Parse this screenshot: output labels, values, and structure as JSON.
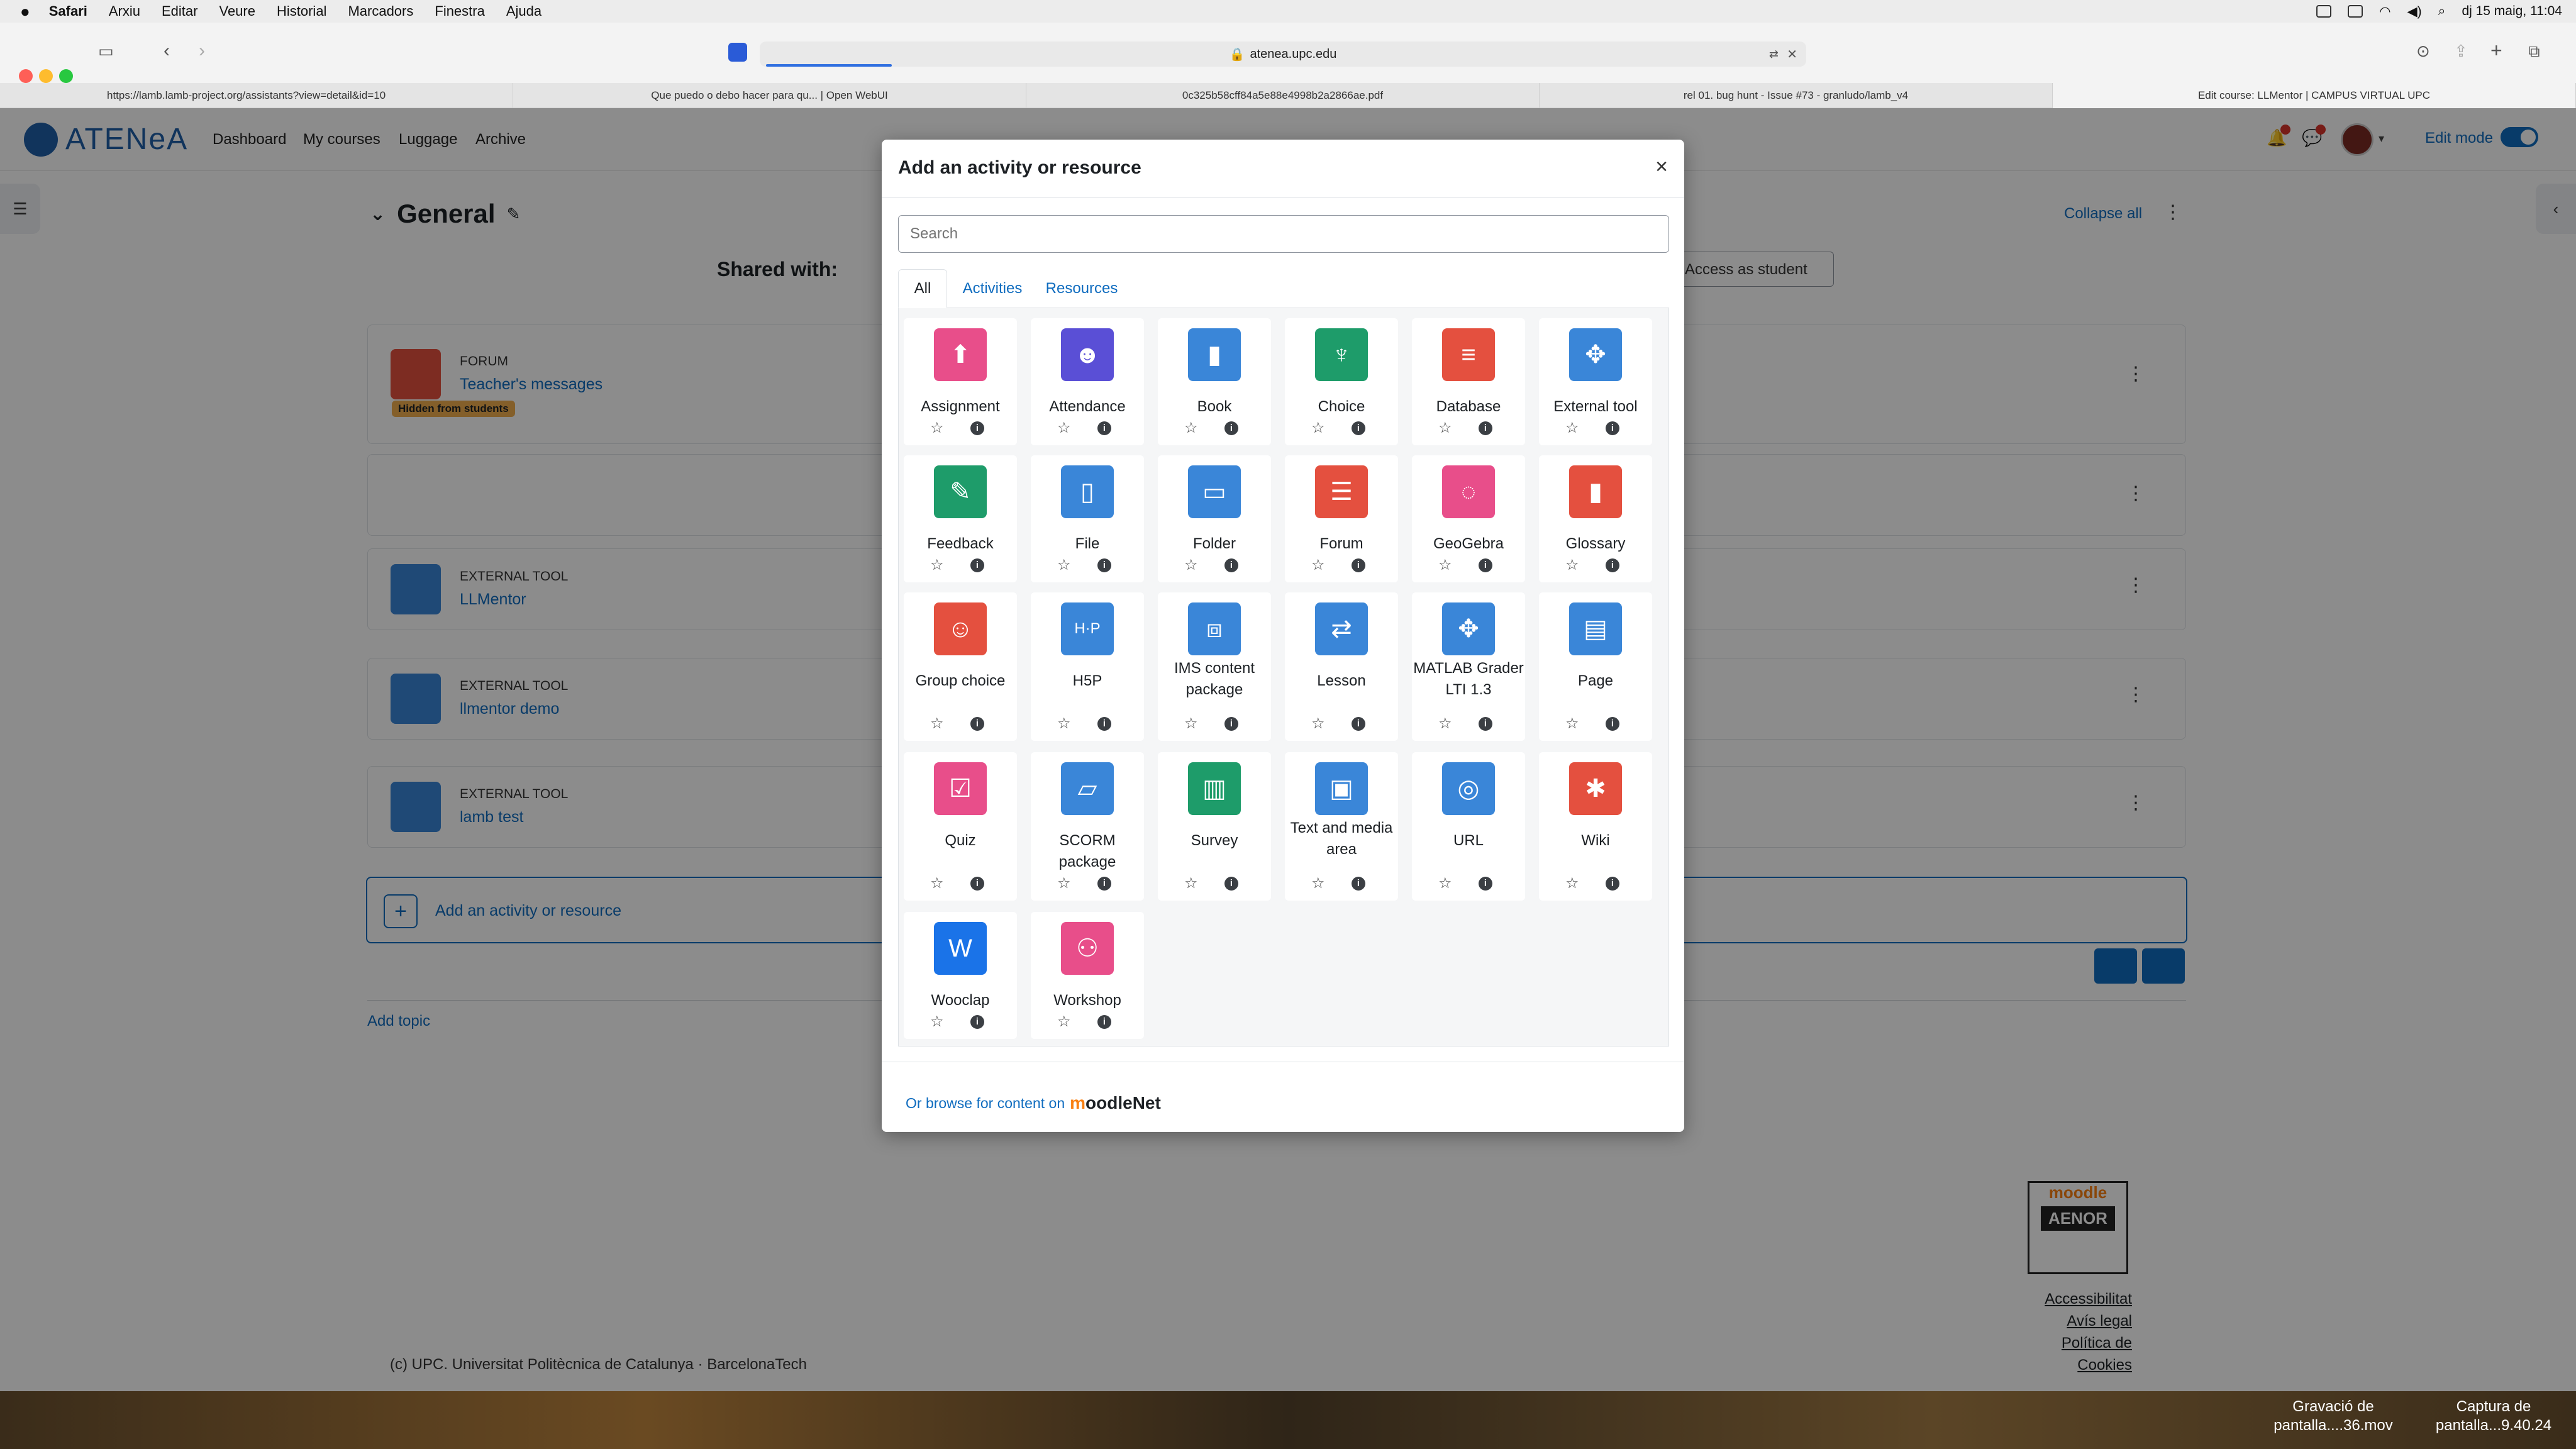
{
  "menubar": {
    "items": [
      "Safari",
      "Arxiu",
      "Editar",
      "Veure",
      "Historial",
      "Marcadors",
      "Finestra",
      "Ajuda"
    ],
    "clock": "dj 15 maig, 11:04"
  },
  "browser": {
    "url": "atenea.upc.edu",
    "tabs": [
      "https://lamb.lamb-project.org/assistants?view=detail&id=10",
      "Que puedo o debo hacer para qu... | Open WebUI",
      "0c325b58cff84a5e88e4998b2a2866ae.pdf",
      "rel 01. bug hunt - Issue #73 - granludo/lamb_v4",
      "Edit course: LLMentor | CAMPUS VIRTUAL UPC"
    ]
  },
  "navbar": {
    "logo": "ATENeA",
    "links": [
      "Dashboard",
      "My courses",
      "Luggage",
      "Archive"
    ],
    "edit_mode": "Edit mode"
  },
  "course": {
    "section_title": "General",
    "collapse_all": "Collapse all",
    "shared_with": "Shared with:",
    "access_as": "Access as student",
    "activities": [
      {
        "kind": "FORUM",
        "name": "Teacher's messages",
        "badge": "Hidden from students"
      },
      {
        "kind": "EXTERNAL TOOL",
        "name": "LLMentor"
      },
      {
        "kind": "EXTERNAL TOOL",
        "name": "llmentor demo"
      },
      {
        "kind": "EXTERNAL TOOL",
        "name": "lamb test"
      }
    ],
    "add_activity": "Add an activity or resource",
    "add_topic": "Add topic"
  },
  "footer": {
    "copyright": "(c) UPC. Universitat Politècnica de Catalunya · BarcelonaTech",
    "links": [
      "Accessibilitat",
      "Avís legal",
      "Política de",
      "Cookies"
    ],
    "badge_line1": "moodle",
    "badge_line2": "AENOR"
  },
  "modal": {
    "title": "Add an activity or resource",
    "close": "×",
    "search_placeholder": "Search",
    "tabs": [
      "All",
      "Activities",
      "Resources"
    ],
    "items": [
      {
        "label": "Assignment",
        "color": "#e84e8a"
      },
      {
        "label": "Attendance",
        "color": "#5a4fd6"
      },
      {
        "label": "Book",
        "color": "#3a86d8"
      },
      {
        "label": "Choice",
        "color": "#1e9c6a"
      },
      {
        "label": "Database",
        "color": "#e4503f"
      },
      {
        "label": "External tool",
        "color": "#3a86d8"
      },
      {
        "label": "Feedback",
        "color": "#1e9c6a"
      },
      {
        "label": "File",
        "color": "#3a86d8"
      },
      {
        "label": "Folder",
        "color": "#3a86d8"
      },
      {
        "label": "Forum",
        "color": "#e4503f"
      },
      {
        "label": "GeoGebra",
        "color": "#e84e8a"
      },
      {
        "label": "Glossary",
        "color": "#e4503f"
      },
      {
        "label": "Group choice",
        "color": "#e4503f"
      },
      {
        "label": "H5P",
        "color": "#3a86d8"
      },
      {
        "label": "IMS content package",
        "color": "#3a86d8"
      },
      {
        "label": "Lesson",
        "color": "#3a86d8"
      },
      {
        "label": "MATLAB Grader LTI 1.3",
        "color": "#3a86d8"
      },
      {
        "label": "Page",
        "color": "#3a86d8"
      },
      {
        "label": "Quiz",
        "color": "#e84e8a"
      },
      {
        "label": "SCORM package",
        "color": "#3a86d8"
      },
      {
        "label": "Survey",
        "color": "#1e9c6a"
      },
      {
        "label": "Text and media area",
        "color": "#3a86d8"
      },
      {
        "label": "URL",
        "color": "#3a86d8"
      },
      {
        "label": "Wiki",
        "color": "#e4503f"
      },
      {
        "label": "Wooclap",
        "color": "#1a73e8"
      },
      {
        "label": "Workshop",
        "color": "#e84e8a"
      }
    ],
    "browse_text": "Or browse for content on",
    "browse_brand_m": "m",
    "browse_brand_rest": "oodle",
    "browse_brand_net": "Net"
  },
  "desktop": {
    "file1": "Gravació de pantalla....36.mov",
    "file2": "Captura de pantalla...9.40.24"
  }
}
